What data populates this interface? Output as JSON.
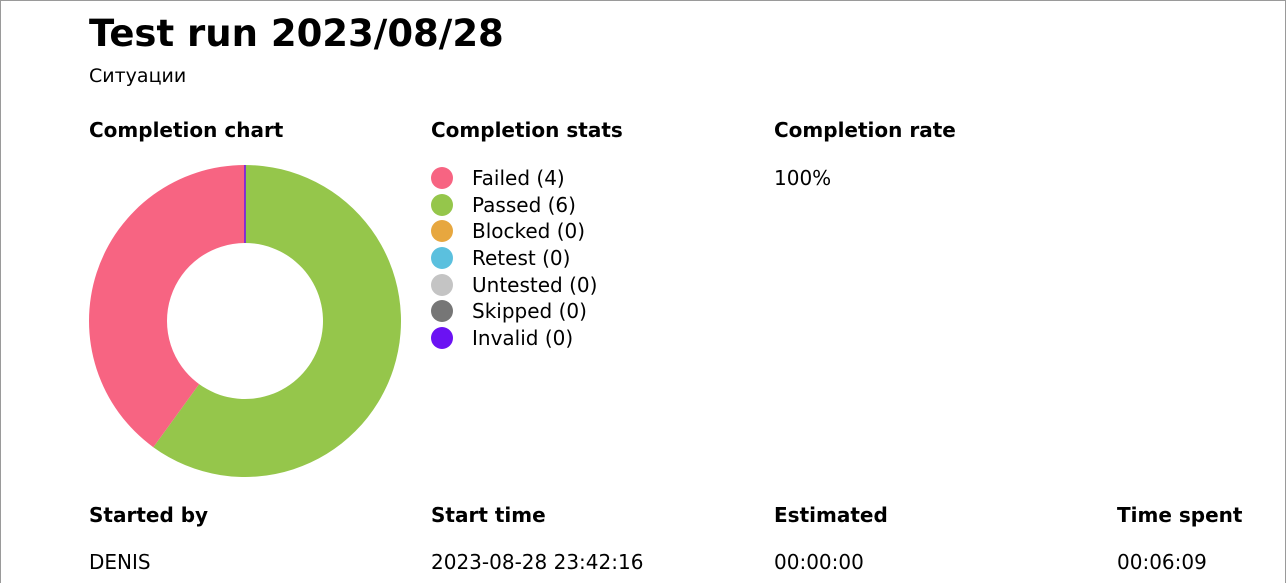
{
  "header": {
    "title": "Test run 2023/08/28",
    "subtitle": "Ситуации"
  },
  "sections": {
    "chart_heading": "Completion chart",
    "stats_heading": "Completion stats",
    "rate_heading": "Completion rate",
    "rate_value": "100%"
  },
  "legend": [
    {
      "label": "Failed (4)",
      "color": "#f76482"
    },
    {
      "label": "Passed (6)",
      "color": "#95c64b"
    },
    {
      "label": "Blocked (0)",
      "color": "#e7a73f"
    },
    {
      "label": "Retest (0)",
      "color": "#5bc0de"
    },
    {
      "label": "Untested (0)",
      "color": "#c4c4c4"
    },
    {
      "label": "Skipped (0)",
      "color": "#767676"
    },
    {
      "label": "Invalid (0)",
      "color": "#6b12f3"
    }
  ],
  "chart_data": {
    "type": "pie",
    "donut": true,
    "categories": [
      "Passed",
      "Failed",
      "Invalid",
      "Blocked",
      "Retest",
      "Untested",
      "Skipped"
    ],
    "values": [
      6,
      4,
      0,
      0,
      0,
      0,
      0
    ],
    "colors": [
      "#95c64b",
      "#f76482",
      "#6b12f3",
      "#e7a73f",
      "#5bc0de",
      "#c4c4c4",
      "#767676"
    ]
  },
  "details": {
    "started_by_label": "Started by",
    "started_by_value": "DENIS",
    "start_time_label": "Start time",
    "start_time_value": "2023-08-28 23:42:16",
    "estimated_label": "Estimated",
    "estimated_value": "00:00:00",
    "time_spent_label": "Time spent",
    "time_spent_value": "00:06:09"
  }
}
